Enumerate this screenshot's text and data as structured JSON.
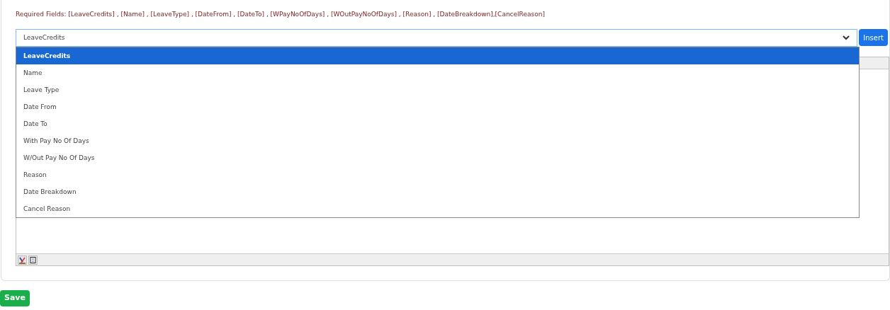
{
  "required_fields": "Required Fields: [LeaveCredits] , [Name] , [LeaveType] , [DateFrom] , [DateTo] , [WPayNoOfDays] , [WOutPayNoOfDays] , [Reason] , [DateBreakdown],[CancelReason]",
  "field_select": {
    "value": "LeaveCredits",
    "expanded": true,
    "options": [
      {
        "label": "LeaveCredits",
        "selected": true
      },
      {
        "label": "Name",
        "selected": false
      },
      {
        "label": "Leave Type",
        "selected": false
      },
      {
        "label": "Date From",
        "selected": false
      },
      {
        "label": "Date To",
        "selected": false
      },
      {
        "label": "With Pay No Of Days",
        "selected": false
      },
      {
        "label": "W/Out Pay No Of Days",
        "selected": false
      },
      {
        "label": "Reason",
        "selected": false
      },
      {
        "label": "Date Breakdown",
        "selected": false
      },
      {
        "label": "Cancel Reason",
        "selected": false
      }
    ]
  },
  "insert_button": "Insert",
  "save_button": "Save"
}
